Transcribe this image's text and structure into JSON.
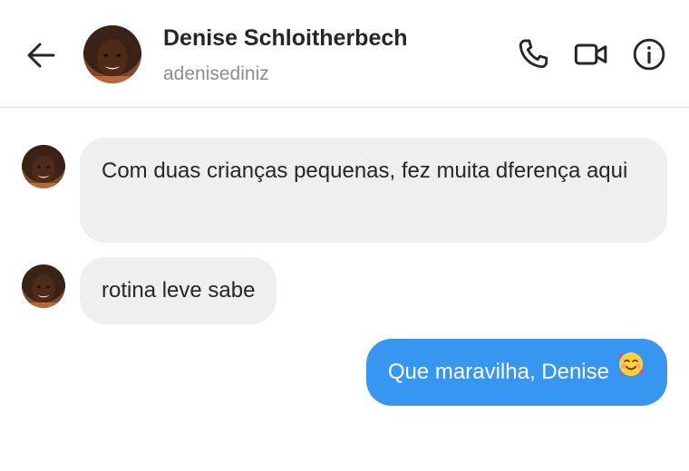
{
  "header": {
    "contact_name": "Denise Schloitherbech",
    "contact_handle": "adenisediniz",
    "icons": [
      "back-arrow-icon",
      "phone-icon",
      "video-camera-icon",
      "info-icon"
    ]
  },
  "messages": [
    {
      "direction": "incoming",
      "text": "Com duas crianças pequenas, fez muita dferença aqui"
    },
    {
      "direction": "incoming",
      "text": "rotina leve sabe"
    },
    {
      "direction": "outgoing",
      "text": "Que maravilha, Denise",
      "emoji": "smiling-face-with-hearts"
    }
  ],
  "colors": {
    "incoming_bubble": "#efefef",
    "outgoing_bubble": "#3797f0",
    "handle_text": "#8e8e8e"
  }
}
